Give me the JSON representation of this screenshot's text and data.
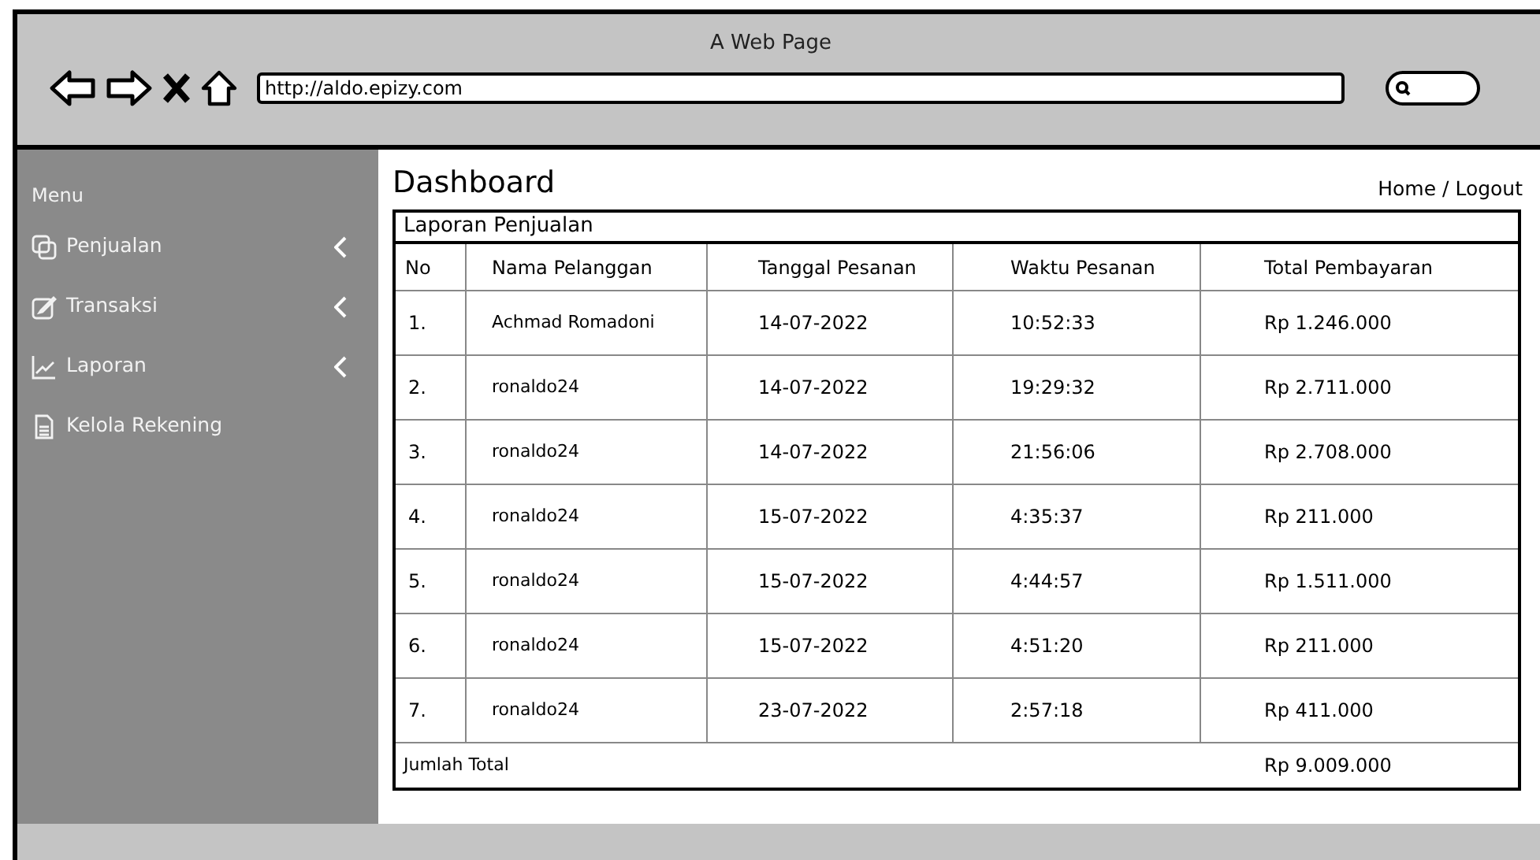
{
  "window": {
    "title": "A Web Page",
    "url": "http://aldo.epizy.com"
  },
  "sidebar": {
    "heading": "Menu",
    "items": [
      {
        "label": "Penjualan",
        "expandable": true
      },
      {
        "label": "Transaksi",
        "expandable": true
      },
      {
        "label": "Laporan",
        "expandable": true
      },
      {
        "label": "Kelola Rekening",
        "expandable": false
      }
    ]
  },
  "page": {
    "title": "Dashboard",
    "links": "Home / Logout"
  },
  "table": {
    "title": "Laporan Penjualan",
    "columns": [
      "No",
      "Nama Pelanggan",
      "Tanggal Pesanan",
      "Waktu Pesanan",
      "Total Pembayaran"
    ],
    "rows": [
      [
        "1.",
        "Achmad Romadoni",
        "14-07-2022",
        "10:52:33",
        "Rp 1.246.000"
      ],
      [
        "2.",
        "ronaldo24",
        "14-07-2022",
        "19:29:32",
        "Rp 2.711.000"
      ],
      [
        "3.",
        "ronaldo24",
        "14-07-2022",
        "21:56:06",
        "Rp 2.708.000"
      ],
      [
        "4.",
        "ronaldo24",
        "15-07-2022",
        "4:35:37",
        "Rp 211.000"
      ],
      [
        "5.",
        "ronaldo24",
        "15-07-2022",
        "4:44:57",
        "Rp 1.511.000"
      ],
      [
        "6.",
        "ronaldo24",
        "15-07-2022",
        "4:51:20",
        "Rp 211.000"
      ],
      [
        "7.",
        "ronaldo24",
        "23-07-2022",
        "2:57:18",
        "Rp 411.000"
      ]
    ],
    "total_label": "Jumlah Total",
    "total_value": "Rp 9.009.000"
  }
}
